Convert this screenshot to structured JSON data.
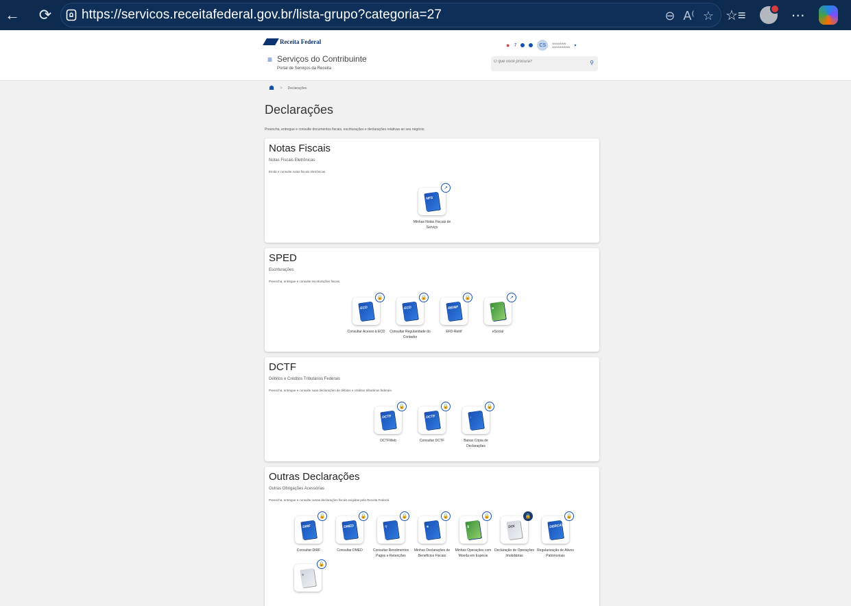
{
  "browser": {
    "url": "https://servicos.receitafederal.gov.br/lista-grupo?categoria=27"
  },
  "header": {
    "logo_text": "Receita Federal",
    "title": "Serviços do Contribuinte",
    "subtitle": "Portal de Serviços da Receita",
    "notification_count": "7",
    "user_initials": "CS",
    "user_name": "NNNNNNN NNNNNNNNN",
    "search_placeholder": "O que você procura?"
  },
  "breadcrumb": {
    "current": "Declarações"
  },
  "page": {
    "title": "Declarações",
    "description": "Preencha, entregue e consulte documentos fiscais, escriturações e declarações relativas ao seu negócio."
  },
  "cards": [
    {
      "title": "Notas Fiscais",
      "subtitle": "Notas Fiscais Eletrônicas",
      "description": "Emita e consulte notas fiscais eletrônicas.",
      "tiles": [
        {
          "label": "Minhas Notas Fiscais de Serviço",
          "icon": "nfse-document-icon",
          "badge": "external"
        }
      ]
    },
    {
      "title": "SPED",
      "subtitle": "Escriturações",
      "description": "Preencha, entregue e consulte escriturações fiscais.",
      "tiles": [
        {
          "label": "Consultar Acesso à ECD",
          "icon": "ecd-document-icon",
          "badge": "lock"
        },
        {
          "label": "Consultar Regularidade do Contador",
          "icon": "ecd-check-icon",
          "badge": "lock"
        },
        {
          "label": "EFD-Reinf",
          "icon": "reinf-document-icon",
          "badge": "lock"
        },
        {
          "label": "eSocial",
          "icon": "esocial-icon",
          "badge": "external"
        }
      ]
    },
    {
      "title": "DCTF",
      "subtitle": "Débitos e Créditos Tributários Federais",
      "description": "Preencha, entregue e consulte suas declarações de débitos e créditos tributários federais.",
      "tiles": [
        {
          "label": "DCTFWeb",
          "icon": "dctf-document-icon",
          "badge": "lock"
        },
        {
          "label": "Consultar DCTF",
          "icon": "dctf-search-icon",
          "badge": "lock"
        },
        {
          "label": "Baixar Cópia de Declarações",
          "icon": "download-document-icon",
          "badge": "lock"
        }
      ]
    },
    {
      "title": "Outras Declarações",
      "subtitle": "Outras Obrigações Acessórias",
      "description": "Preencha, entregue e consulte outras declarações fiscais exigidas pela Receita Federal.",
      "tiles": [
        {
          "label": "Consultar DIRF",
          "icon": "dirf-document-icon",
          "badge": "lock"
        },
        {
          "label": "Consultar DMED",
          "icon": "dmed-document-icon",
          "badge": "lock"
        },
        {
          "label": "Consultar Rendimentos Pagos e Retenções",
          "icon": "rendimentos-search-icon",
          "badge": "lock"
        },
        {
          "label": "Minhas Declarações de Benefícios Fiscais",
          "icon": "beneficios-star-icon",
          "badge": "lock"
        },
        {
          "label": "Minhas Operações com Moeda em Espécie",
          "icon": "money-icon",
          "badge": "lock"
        },
        {
          "label": "Declaração de Operações Imobiliárias",
          "icon": "doi-document-icon",
          "badge": "lock-dark"
        },
        {
          "label": "Regularização de Ativos Patrimoniais",
          "icon": "ativos-document-icon",
          "badge": "lock"
        },
        {
          "label": "",
          "icon": "gray-document-icon",
          "badge": "lock"
        }
      ]
    }
  ],
  "colors": {
    "browser_bg": "#0d2a4f",
    "brand_blue": "#1351b4",
    "page_bg": "#f1f1f1"
  }
}
